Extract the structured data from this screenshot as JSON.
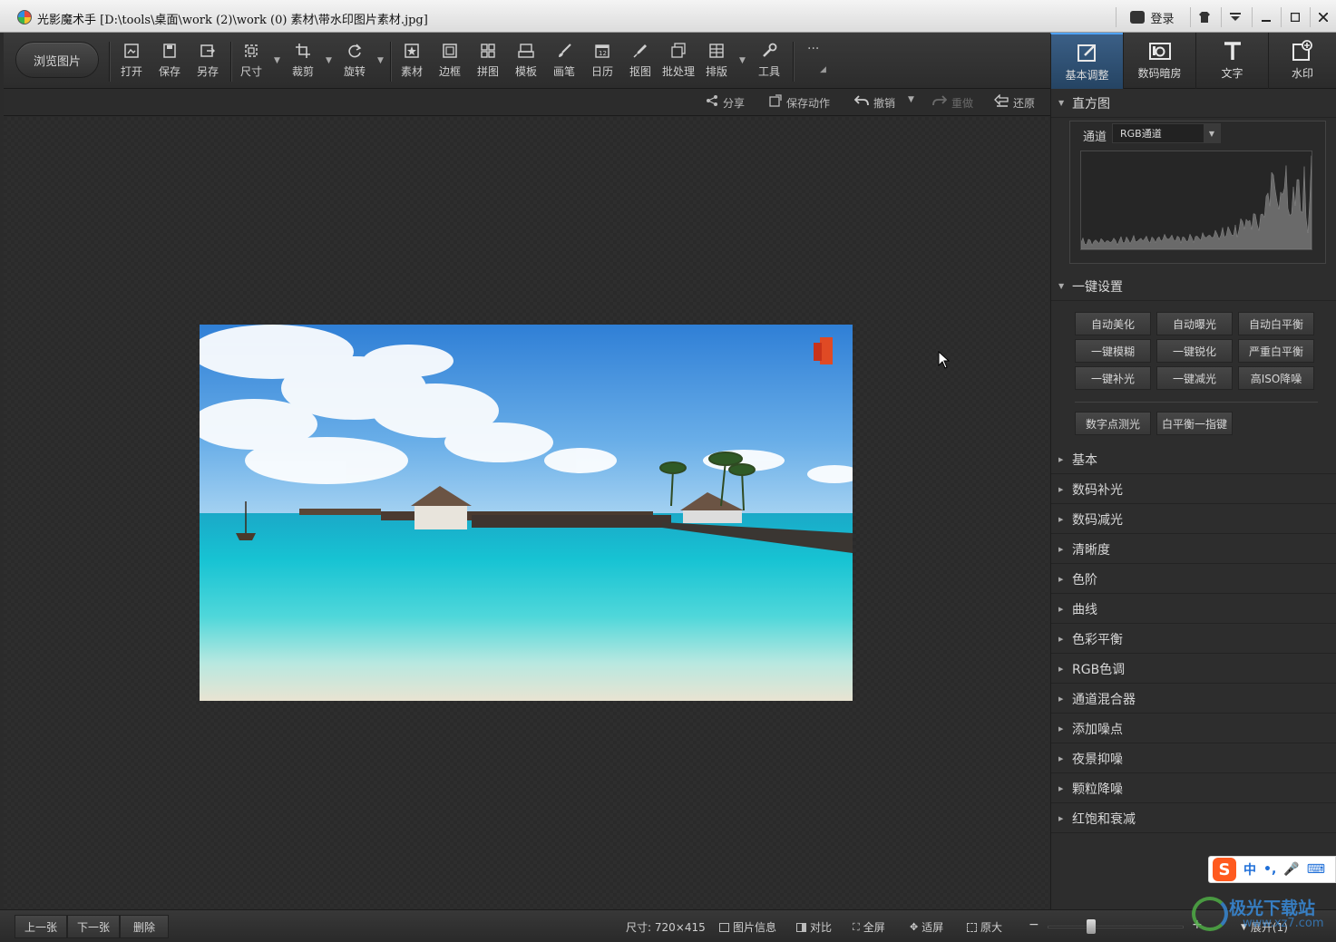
{
  "window": {
    "title": "光影魔术手 [D:\\tools\\桌面\\work (2)\\work (0) 素材\\带水印图片素材.jpg]",
    "login_label": "登录"
  },
  "toolbar": {
    "browse_label": "浏览图片",
    "tools": [
      {
        "label": "打开",
        "icon": "open-icon"
      },
      {
        "label": "保存",
        "icon": "save-icon"
      },
      {
        "label": "另存",
        "icon": "save-as-icon"
      },
      {
        "label": "尺寸",
        "icon": "resize-icon"
      },
      {
        "label": "裁剪",
        "icon": "crop-icon"
      },
      {
        "label": "旋转",
        "icon": "rotate-icon"
      },
      {
        "label": "素材",
        "icon": "material-icon"
      },
      {
        "label": "边框",
        "icon": "frame-icon"
      },
      {
        "label": "拼图",
        "icon": "collage-icon"
      },
      {
        "label": "模板",
        "icon": "template-icon"
      },
      {
        "label": "画笔",
        "icon": "brush-icon"
      },
      {
        "label": "日历",
        "icon": "calendar-icon"
      },
      {
        "label": "抠图",
        "icon": "cutout-icon"
      },
      {
        "label": "批处理",
        "icon": "batch-icon"
      },
      {
        "label": "排版",
        "icon": "layout-icon"
      },
      {
        "label": "工具",
        "icon": "wrench-icon"
      }
    ]
  },
  "right_tabs": [
    {
      "label": "基本调整",
      "icon": "adjust-icon",
      "active": true
    },
    {
      "label": "数码暗房",
      "icon": "darkroom-icon",
      "active": false
    },
    {
      "label": "文字",
      "icon": "text-icon",
      "active": false
    },
    {
      "label": "水印",
      "icon": "watermark-icon",
      "active": false
    }
  ],
  "actions": {
    "share": "分享",
    "save_action": "保存动作",
    "undo": "撤销",
    "redo": "重做",
    "restore": "还原"
  },
  "histogram": {
    "title": "直方图",
    "channel_label": "通道",
    "channel_value": "RGB通道"
  },
  "one_click": {
    "title": "一键设置",
    "buttons": [
      "自动美化",
      "自动曝光",
      "自动白平衡",
      "一键模糊",
      "一键锐化",
      "严重白平衡",
      "一键补光",
      "一键减光",
      "高ISO降噪"
    ],
    "extra_buttons": [
      "数字点测光",
      "白平衡一指键"
    ]
  },
  "sections": [
    "基本",
    "数码补光",
    "数码减光",
    "清晰度",
    "色阶",
    "曲线",
    "色彩平衡",
    "RGB色调",
    "通道混合器",
    "添加噪点",
    "夜景抑噪",
    "颗粒降噪",
    "红饱和衰减"
  ],
  "status": {
    "prev": "上一张",
    "next": "下一张",
    "delete": "删除",
    "size": "尺寸: 720×415",
    "info": "图片信息",
    "compare": "对比",
    "fullscreen": "全屏",
    "fit": "适屏",
    "original": "原大",
    "expand": "展开(1)"
  },
  "ime": {
    "lang": "中"
  },
  "watermark": {
    "text": "极光下载站",
    "url": "www.xz7.com"
  },
  "colors": {
    "accent": "#2f6ea8",
    "background": "#2b2b2b"
  }
}
